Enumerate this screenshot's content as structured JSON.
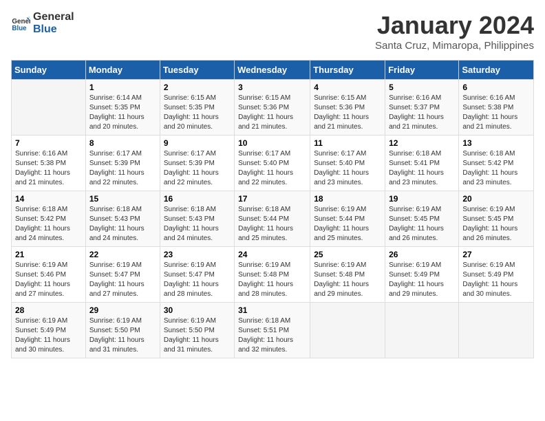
{
  "logo": {
    "line1": "General",
    "line2": "Blue"
  },
  "title": "January 2024",
  "subtitle": "Santa Cruz, Mimaropa, Philippines",
  "days": [
    "Sunday",
    "Monday",
    "Tuesday",
    "Wednesday",
    "Thursday",
    "Friday",
    "Saturday"
  ],
  "weeks": [
    [
      {
        "day": "",
        "info": ""
      },
      {
        "day": "1",
        "info": "Sunrise: 6:14 AM\nSunset: 5:35 PM\nDaylight: 11 hours\nand 20 minutes."
      },
      {
        "day": "2",
        "info": "Sunrise: 6:15 AM\nSunset: 5:35 PM\nDaylight: 11 hours\nand 20 minutes."
      },
      {
        "day": "3",
        "info": "Sunrise: 6:15 AM\nSunset: 5:36 PM\nDaylight: 11 hours\nand 21 minutes."
      },
      {
        "day": "4",
        "info": "Sunrise: 6:15 AM\nSunset: 5:36 PM\nDaylight: 11 hours\nand 21 minutes."
      },
      {
        "day": "5",
        "info": "Sunrise: 6:16 AM\nSunset: 5:37 PM\nDaylight: 11 hours\nand 21 minutes."
      },
      {
        "day": "6",
        "info": "Sunrise: 6:16 AM\nSunset: 5:38 PM\nDaylight: 11 hours\nand 21 minutes."
      }
    ],
    [
      {
        "day": "7",
        "info": "Sunrise: 6:16 AM\nSunset: 5:38 PM\nDaylight: 11 hours\nand 21 minutes."
      },
      {
        "day": "8",
        "info": "Sunrise: 6:17 AM\nSunset: 5:39 PM\nDaylight: 11 hours\nand 22 minutes."
      },
      {
        "day": "9",
        "info": "Sunrise: 6:17 AM\nSunset: 5:39 PM\nDaylight: 11 hours\nand 22 minutes."
      },
      {
        "day": "10",
        "info": "Sunrise: 6:17 AM\nSunset: 5:40 PM\nDaylight: 11 hours\nand 22 minutes."
      },
      {
        "day": "11",
        "info": "Sunrise: 6:17 AM\nSunset: 5:40 PM\nDaylight: 11 hours\nand 23 minutes."
      },
      {
        "day": "12",
        "info": "Sunrise: 6:18 AM\nSunset: 5:41 PM\nDaylight: 11 hours\nand 23 minutes."
      },
      {
        "day": "13",
        "info": "Sunrise: 6:18 AM\nSunset: 5:42 PM\nDaylight: 11 hours\nand 23 minutes."
      }
    ],
    [
      {
        "day": "14",
        "info": "Sunrise: 6:18 AM\nSunset: 5:42 PM\nDaylight: 11 hours\nand 24 minutes."
      },
      {
        "day": "15",
        "info": "Sunrise: 6:18 AM\nSunset: 5:43 PM\nDaylight: 11 hours\nand 24 minutes."
      },
      {
        "day": "16",
        "info": "Sunrise: 6:18 AM\nSunset: 5:43 PM\nDaylight: 11 hours\nand 24 minutes."
      },
      {
        "day": "17",
        "info": "Sunrise: 6:18 AM\nSunset: 5:44 PM\nDaylight: 11 hours\nand 25 minutes."
      },
      {
        "day": "18",
        "info": "Sunrise: 6:19 AM\nSunset: 5:44 PM\nDaylight: 11 hours\nand 25 minutes."
      },
      {
        "day": "19",
        "info": "Sunrise: 6:19 AM\nSunset: 5:45 PM\nDaylight: 11 hours\nand 26 minutes."
      },
      {
        "day": "20",
        "info": "Sunrise: 6:19 AM\nSunset: 5:45 PM\nDaylight: 11 hours\nand 26 minutes."
      }
    ],
    [
      {
        "day": "21",
        "info": "Sunrise: 6:19 AM\nSunset: 5:46 PM\nDaylight: 11 hours\nand 27 minutes."
      },
      {
        "day": "22",
        "info": "Sunrise: 6:19 AM\nSunset: 5:47 PM\nDaylight: 11 hours\nand 27 minutes."
      },
      {
        "day": "23",
        "info": "Sunrise: 6:19 AM\nSunset: 5:47 PM\nDaylight: 11 hours\nand 28 minutes."
      },
      {
        "day": "24",
        "info": "Sunrise: 6:19 AM\nSunset: 5:48 PM\nDaylight: 11 hours\nand 28 minutes."
      },
      {
        "day": "25",
        "info": "Sunrise: 6:19 AM\nSunset: 5:48 PM\nDaylight: 11 hours\nand 29 minutes."
      },
      {
        "day": "26",
        "info": "Sunrise: 6:19 AM\nSunset: 5:49 PM\nDaylight: 11 hours\nand 29 minutes."
      },
      {
        "day": "27",
        "info": "Sunrise: 6:19 AM\nSunset: 5:49 PM\nDaylight: 11 hours\nand 30 minutes."
      }
    ],
    [
      {
        "day": "28",
        "info": "Sunrise: 6:19 AM\nSunset: 5:49 PM\nDaylight: 11 hours\nand 30 minutes."
      },
      {
        "day": "29",
        "info": "Sunrise: 6:19 AM\nSunset: 5:50 PM\nDaylight: 11 hours\nand 31 minutes."
      },
      {
        "day": "30",
        "info": "Sunrise: 6:19 AM\nSunset: 5:50 PM\nDaylight: 11 hours\nand 31 minutes."
      },
      {
        "day": "31",
        "info": "Sunrise: 6:18 AM\nSunset: 5:51 PM\nDaylight: 11 hours\nand 32 minutes."
      },
      {
        "day": "",
        "info": ""
      },
      {
        "day": "",
        "info": ""
      },
      {
        "day": "",
        "info": ""
      }
    ]
  ]
}
